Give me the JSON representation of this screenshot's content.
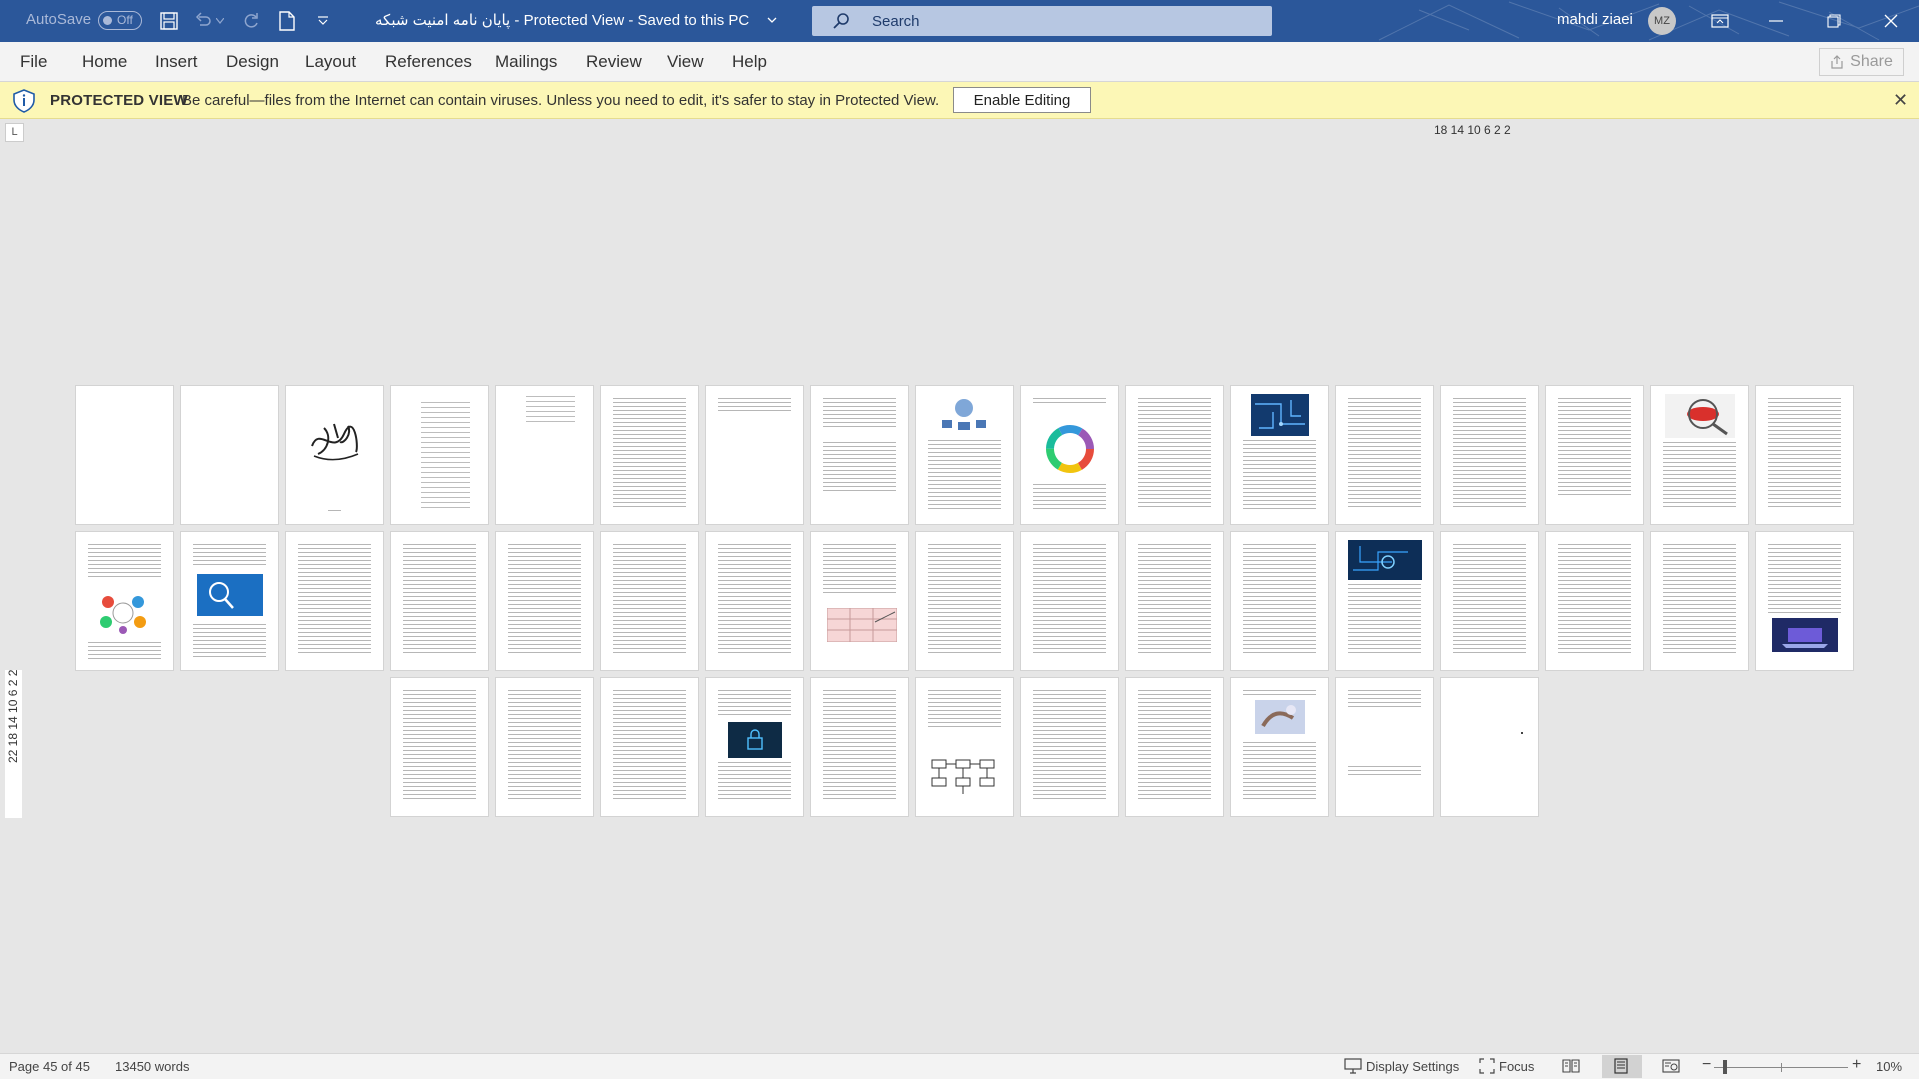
{
  "titlebar": {
    "autosave_label": "AutoSave",
    "autosave_state": "Off",
    "document_title": "پایان نامه امنیت شبکه  -  Protected View  -  Saved to this PC",
    "search_placeholder": "Search",
    "user_name": "mahdi ziaei",
    "user_initials": "MZ",
    "background_color": "#2b579a"
  },
  "ribbon": {
    "tabs": [
      "File",
      "Home",
      "Insert",
      "Design",
      "Layout",
      "References",
      "Mailings",
      "Review",
      "View",
      "Help"
    ],
    "share_label": "Share"
  },
  "protected_view": {
    "title": "PROTECTED VIEW",
    "message": "Be careful—files from the Internet can contain viruses. Unless you need to edit, it's safer to stay in Protected View.",
    "enable_button": "Enable Editing",
    "background_color": "#fcf7b6"
  },
  "rulers": {
    "horizontal": "18 14 10  6   2  2",
    "vertical": "22 18 14 10  6  2  2",
    "tab_selector": "L"
  },
  "pages": {
    "count": 45,
    "thumbnail_content": [
      "blank",
      "blank",
      "calligraphy-image",
      "toc",
      "toc",
      "text",
      "top-text",
      "text-list",
      "server-diagram",
      "circle-diagram",
      "text",
      "circuit-image",
      "text",
      "text",
      "text",
      "error-image",
      "text",
      "kpi-diagram",
      "internet-image",
      "text",
      "text",
      "text",
      "text",
      "text",
      "table-image",
      "text",
      "text",
      "text",
      "text",
      "security-image",
      "text",
      "text",
      "text",
      "laptop-image",
      "text",
      "text",
      "text",
      "lock-image",
      "text",
      "flowchart",
      "text",
      "text",
      "hand-image",
      "short-text",
      "blank"
    ]
  },
  "statusbar": {
    "page_info": "Page 45 of 45",
    "word_count": "13450 words",
    "display_settings": "Display Settings",
    "focus": "Focus",
    "zoom_level": "10%"
  }
}
